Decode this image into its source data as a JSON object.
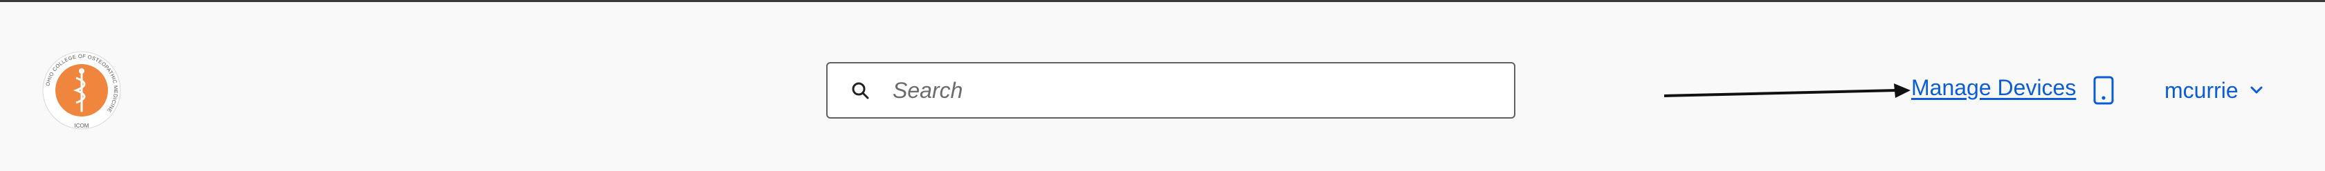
{
  "app": {
    "logo_text_ring": "OHIO COLLEGE OF OSTEOPATHIC MEDICINE",
    "logo_abbrev": "ICOM",
    "brand_color": "#f0863e"
  },
  "search": {
    "placeholder": "Search",
    "value": "",
    "icon": "search-icon"
  },
  "nav": {
    "manage_devices_label": "Manage Devices",
    "device_icon": "mobile-device-icon",
    "link_color": "#0b5cd7"
  },
  "user": {
    "name": "mcurrie",
    "menu_icon": "chevron-down-icon"
  }
}
